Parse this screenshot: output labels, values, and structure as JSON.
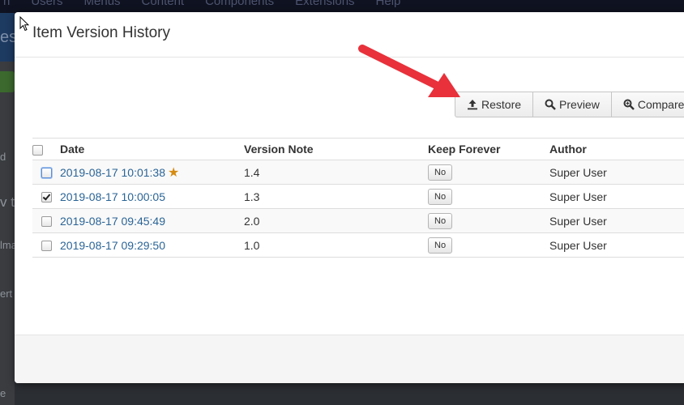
{
  "background": {
    "menu": [
      "n",
      "Users",
      "Menus",
      "Content",
      "Components",
      "Extensions",
      "Help"
    ],
    "header_fragment": "es",
    "side_texts": [
      "d",
      "v to",
      "lma",
      "ert",
      "e"
    ]
  },
  "modal": {
    "title": "Item Version History",
    "toolbar": {
      "restore": "Restore",
      "preview": "Preview",
      "compare": "Compare"
    },
    "columns": [
      "Date",
      "Version Note",
      "Keep Forever",
      "Author"
    ],
    "rows": [
      {
        "date": "2019-08-17 10:01:38",
        "note": "1.4",
        "keep": "No",
        "author": "Super User",
        "checked": false,
        "current": true
      },
      {
        "date": "2019-08-17 10:00:05",
        "note": "1.3",
        "keep": "No",
        "author": "Super User",
        "checked": true,
        "current": false
      },
      {
        "date": "2019-08-17 09:45:49",
        "note": "2.0",
        "keep": "No",
        "author": "Super User",
        "checked": false,
        "current": false
      },
      {
        "date": "2019-08-17 09:29:50",
        "note": "1.0",
        "keep": "No",
        "author": "Super User",
        "checked": false,
        "current": false
      }
    ]
  },
  "icons": {
    "restore": "upload-icon",
    "preview": "search-icon",
    "compare": "zoom-in-icon",
    "current_version": "star-icon"
  },
  "colors": {
    "annotation_arrow": "#e8313b",
    "link": "#2a6496",
    "star": "#d58b12"
  }
}
